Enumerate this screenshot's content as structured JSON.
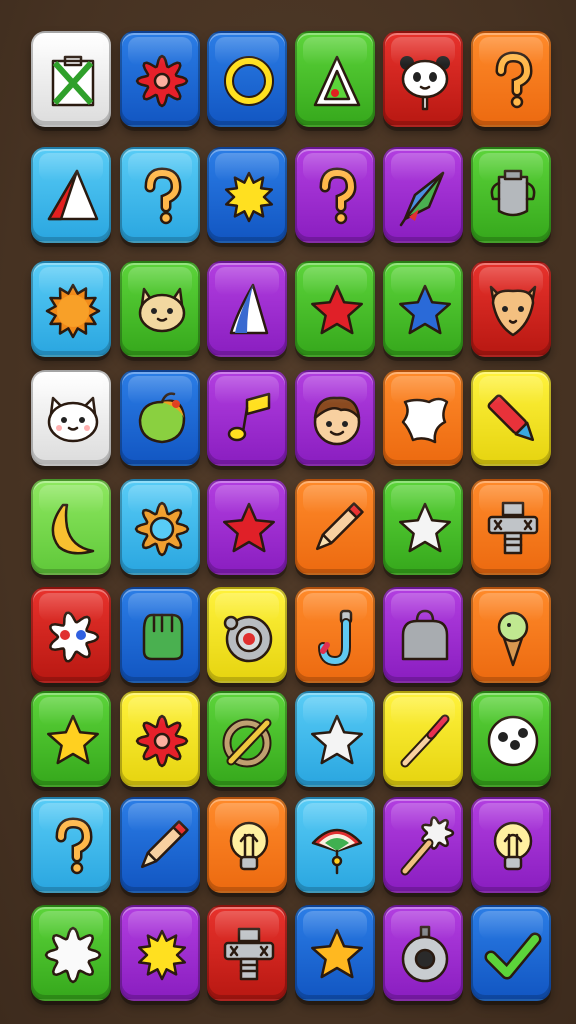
{
  "board": {
    "columns": 6,
    "rows": 9,
    "tiles": [
      {
        "color": "white",
        "icon": "package-box-icon"
      },
      {
        "color": "blue",
        "icon": "red-gear-icon"
      },
      {
        "color": "blue",
        "icon": "yellow-ring-icon"
      },
      {
        "color": "green",
        "icon": "triangle-ruler-icon"
      },
      {
        "color": "red",
        "icon": "panda-face-icon"
      },
      {
        "color": "orange",
        "icon": "question-mark-icon"
      },
      {
        "color": "sky",
        "icon": "red-triangle-icon"
      },
      {
        "color": "sky",
        "icon": "question-mark-icon"
      },
      {
        "color": "blue",
        "icon": "yellow-splash-icon"
      },
      {
        "color": "purple",
        "icon": "question-mark-icon"
      },
      {
        "color": "purple",
        "icon": "kite-icon"
      },
      {
        "color": "green",
        "icon": "trophy-cup-icon"
      },
      {
        "color": "sky",
        "icon": "sun-icon"
      },
      {
        "color": "green",
        "icon": "cat-face-icon"
      },
      {
        "color": "purple",
        "icon": "blue-cone-icon"
      },
      {
        "color": "green",
        "icon": "red-star-icon"
      },
      {
        "color": "green",
        "icon": "blue-star-icon"
      },
      {
        "color": "red",
        "icon": "fox-face-icon"
      },
      {
        "color": "white",
        "icon": "white-cat-face-icon"
      },
      {
        "color": "blue",
        "icon": "fruit-icon"
      },
      {
        "color": "purple",
        "icon": "music-note-icon"
      },
      {
        "color": "purple",
        "icon": "boy-face-icon"
      },
      {
        "color": "orange",
        "icon": "paper-sheet-icon"
      },
      {
        "color": "yellow",
        "icon": "crayon-icon"
      },
      {
        "color": "lime",
        "icon": "banana-icon"
      },
      {
        "color": "sky",
        "icon": "orange-gear-icon"
      },
      {
        "color": "purple",
        "icon": "red-star-icon"
      },
      {
        "color": "orange",
        "icon": "pencil-icon"
      },
      {
        "color": "green",
        "icon": "white-star-icon"
      },
      {
        "color": "orange",
        "icon": "bolt-icon"
      },
      {
        "color": "red",
        "icon": "cloud-dots-icon"
      },
      {
        "color": "blue",
        "icon": "glove-icon"
      },
      {
        "color": "yellow",
        "icon": "target-icon"
      },
      {
        "color": "orange",
        "icon": "hook-icon"
      },
      {
        "color": "purple",
        "icon": "bag-icon"
      },
      {
        "color": "orange",
        "icon": "ice-cream-icon"
      },
      {
        "color": "green",
        "icon": "yellow-star-icon"
      },
      {
        "color": "yellow",
        "icon": "red-gear-icon"
      },
      {
        "color": "green",
        "icon": "wrench-ring-icon"
      },
      {
        "color": "sky",
        "icon": "white-star-icon"
      },
      {
        "color": "yellow",
        "icon": "paintbrush-icon"
      },
      {
        "color": "green",
        "icon": "dice-ball-icon"
      },
      {
        "color": "sky",
        "icon": "question-mark-icon"
      },
      {
        "color": "blue",
        "icon": "pencil-icon"
      },
      {
        "color": "orange",
        "icon": "light-bulb-icon"
      },
      {
        "color": "sky",
        "icon": "rainbow-fan-icon"
      },
      {
        "color": "purple",
        "icon": "feather-duster-icon"
      },
      {
        "color": "purple",
        "icon": "light-bulb-icon"
      },
      {
        "color": "green",
        "icon": "white-cloud-icon"
      },
      {
        "color": "purple",
        "icon": "yellow-splash-icon"
      },
      {
        "color": "red",
        "icon": "bolt-icon"
      },
      {
        "color": "blue",
        "icon": "gold-star-icon"
      },
      {
        "color": "purple",
        "icon": "washer-icon"
      },
      {
        "color": "blue",
        "icon": "check-mark-icon"
      }
    ]
  }
}
